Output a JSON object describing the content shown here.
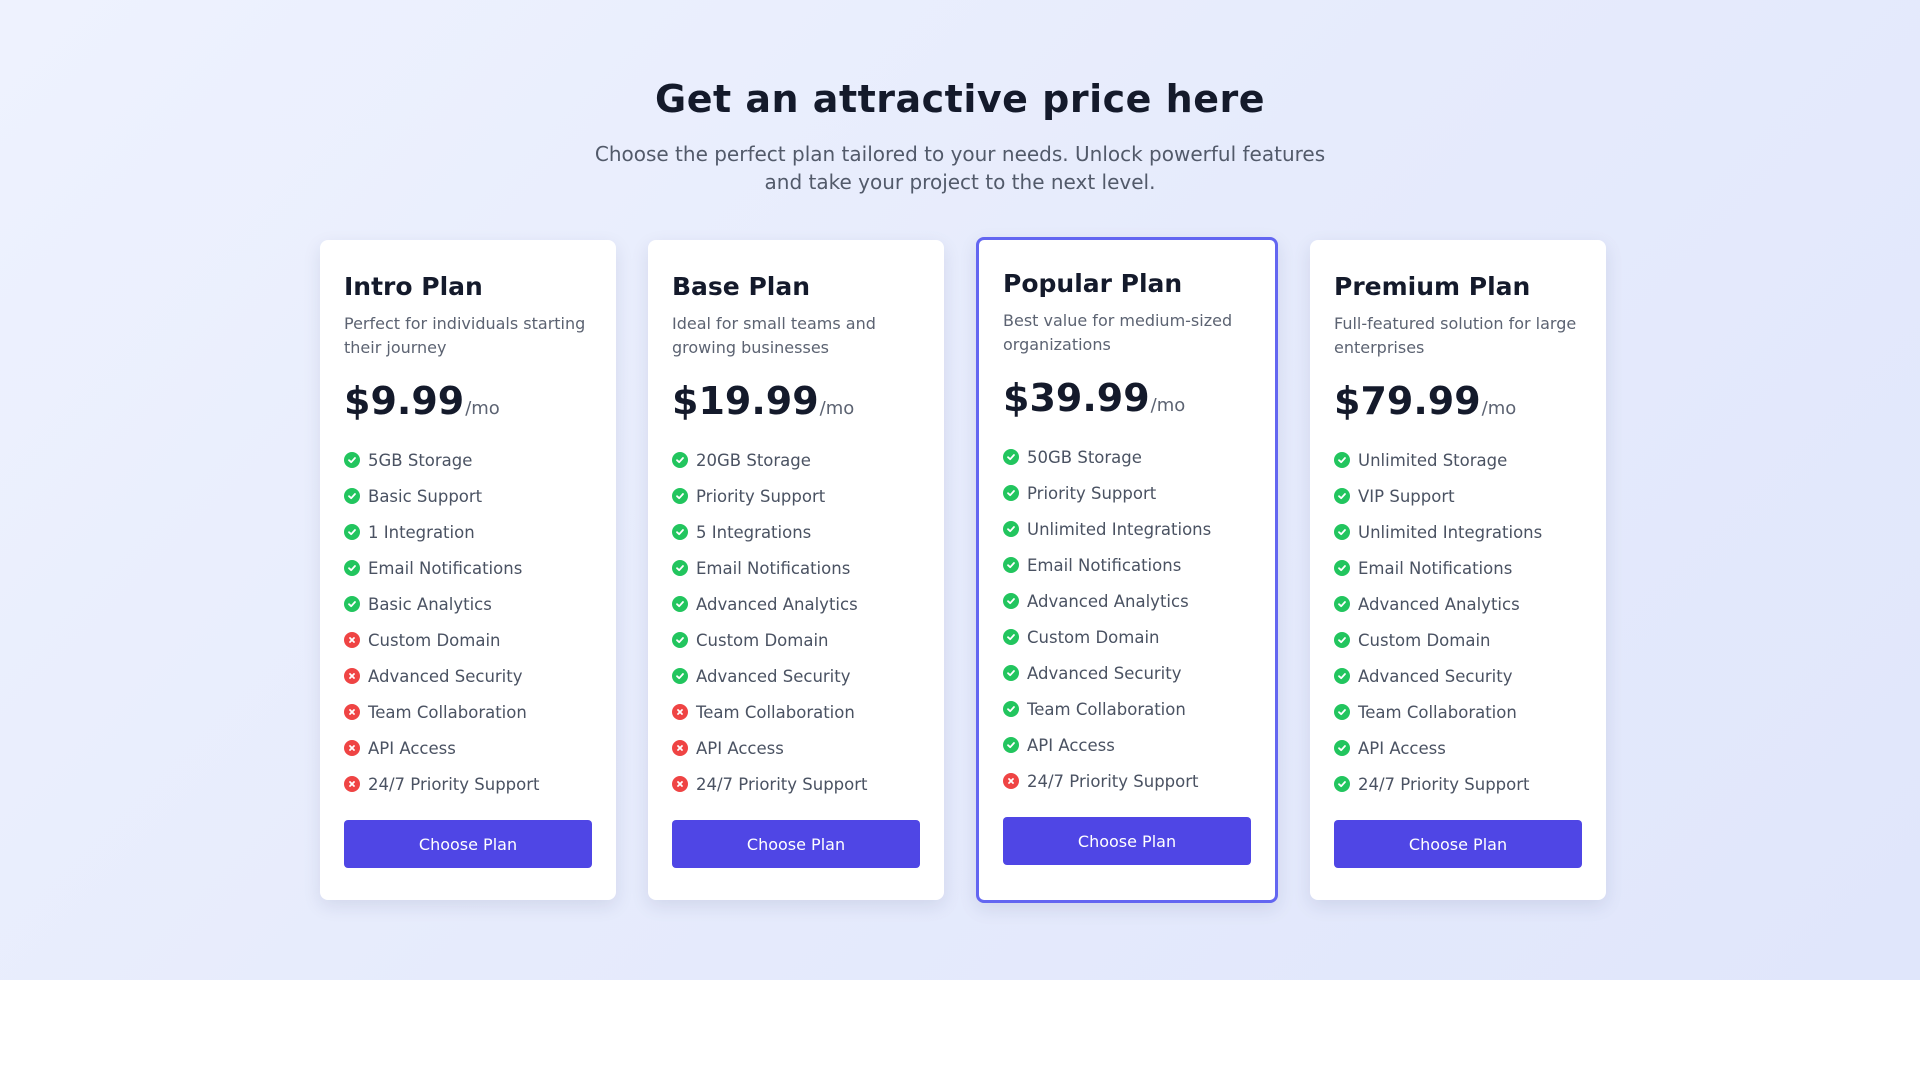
{
  "header": {
    "title": "Get an attractive price here",
    "subtitle": "Choose the perfect plan tailored to your needs. Unlock powerful features and take your project to the next level."
  },
  "colors": {
    "accent": "#4f46e5",
    "highlight_border": "#6366f1",
    "included": "#22c55e",
    "excluded": "#ef4444"
  },
  "icons": {
    "included": "check-circle-icon",
    "excluded": "x-circle-icon"
  },
  "plans": [
    {
      "name": "Intro Plan",
      "description": "Perfect for individuals starting their journey",
      "price": "$9.99",
      "period": "/mo",
      "button_label": "Choose Plan",
      "highlighted": false,
      "features": [
        {
          "label": "5GB Storage",
          "included": true
        },
        {
          "label": "Basic Support",
          "included": true
        },
        {
          "label": "1 Integration",
          "included": true
        },
        {
          "label": "Email Notifications",
          "included": true
        },
        {
          "label": "Basic Analytics",
          "included": true
        },
        {
          "label": "Custom Domain",
          "included": false
        },
        {
          "label": "Advanced Security",
          "included": false
        },
        {
          "label": "Team Collaboration",
          "included": false
        },
        {
          "label": "API Access",
          "included": false
        },
        {
          "label": "24/7 Priority Support",
          "included": false
        }
      ]
    },
    {
      "name": "Base Plan",
      "description": "Ideal for small teams and growing businesses",
      "price": "$19.99",
      "period": "/mo",
      "button_label": "Choose Plan",
      "highlighted": false,
      "features": [
        {
          "label": "20GB Storage",
          "included": true
        },
        {
          "label": "Priority Support",
          "included": true
        },
        {
          "label": "5 Integrations",
          "included": true
        },
        {
          "label": "Email Notifications",
          "included": true
        },
        {
          "label": "Advanced Analytics",
          "included": true
        },
        {
          "label": "Custom Domain",
          "included": true
        },
        {
          "label": "Advanced Security",
          "included": true
        },
        {
          "label": "Team Collaboration",
          "included": false
        },
        {
          "label": "API Access",
          "included": false
        },
        {
          "label": "24/7 Priority Support",
          "included": false
        }
      ]
    },
    {
      "name": "Popular Plan",
      "description": "Best value for medium-sized organizations",
      "price": "$39.99",
      "period": "/mo",
      "button_label": "Choose Plan",
      "highlighted": true,
      "features": [
        {
          "label": "50GB Storage",
          "included": true
        },
        {
          "label": "Priority Support",
          "included": true
        },
        {
          "label": "Unlimited Integrations",
          "included": true
        },
        {
          "label": "Email Notifications",
          "included": true
        },
        {
          "label": "Advanced Analytics",
          "included": true
        },
        {
          "label": "Custom Domain",
          "included": true
        },
        {
          "label": "Advanced Security",
          "included": true
        },
        {
          "label": "Team Collaboration",
          "included": true
        },
        {
          "label": "API Access",
          "included": true
        },
        {
          "label": "24/7 Priority Support",
          "included": false
        }
      ]
    },
    {
      "name": "Premium Plan",
      "description": "Full-featured solution for large enterprises",
      "price": "$79.99",
      "period": "/mo",
      "button_label": "Choose Plan",
      "highlighted": false,
      "features": [
        {
          "label": "Unlimited Storage",
          "included": true
        },
        {
          "label": "VIP Support",
          "included": true
        },
        {
          "label": "Unlimited Integrations",
          "included": true
        },
        {
          "label": "Email Notifications",
          "included": true
        },
        {
          "label": "Advanced Analytics",
          "included": true
        },
        {
          "label": "Custom Domain",
          "included": true
        },
        {
          "label": "Advanced Security",
          "included": true
        },
        {
          "label": "Team Collaboration",
          "included": true
        },
        {
          "label": "API Access",
          "included": true
        },
        {
          "label": "24/7 Priority Support",
          "included": true
        }
      ]
    }
  ]
}
